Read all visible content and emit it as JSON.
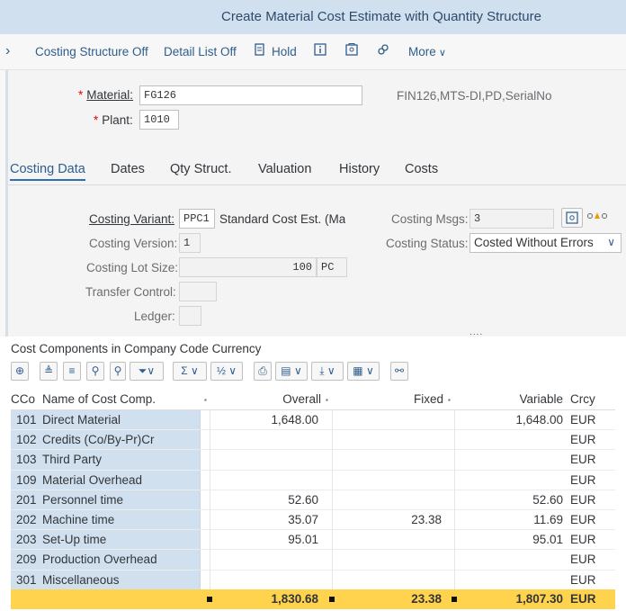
{
  "window": {
    "title": "Create Material Cost Estimate with Quantity Structure"
  },
  "toolbar": {
    "nav_chevron": "›",
    "costing_structure_off": "Costing Structure Off",
    "detail_list_off": "Detail List Off",
    "hold": "Hold",
    "more": "More"
  },
  "header": {
    "material_label": "Material:",
    "material_value": "FG126",
    "material_desc": "FIN126,MTS-DI,PD,SerialNo",
    "plant_label": "Plant:",
    "plant_value": "1010",
    "required_mark": "*"
  },
  "tabs": [
    {
      "label": "Costing Data",
      "active": true
    },
    {
      "label": "Dates"
    },
    {
      "label": "Qty Struct."
    },
    {
      "label": "Valuation"
    },
    {
      "label": "History"
    },
    {
      "label": "Costs"
    }
  ],
  "costing": {
    "variant_label": "Costing Variant:",
    "variant_value": "PPC1",
    "variant_desc": "Standard Cost Est. (Ma.",
    "version_label": "Costing Version:",
    "version_value": "1",
    "lot_size_label": "Costing Lot Size:",
    "lot_size_value": "100",
    "lot_size_unit": "PC",
    "transfer_label": "Transfer Control:",
    "ledger_label": "Ledger:",
    "msgs_label": "Costing Msgs:",
    "msgs_value": "3",
    "status_label": "Costing Status:",
    "status_value": "Costed Without Errors"
  },
  "section": {
    "title": "Cost Components in Company Code Currency",
    "splitter": "....",
    "columns": {
      "cco": "CCo",
      "name": "Name of Cost Comp.",
      "overall": "Overall",
      "fixed": "Fixed",
      "variable": "Variable",
      "crcy": "Crcy"
    },
    "rows": [
      {
        "cco": "101",
        "name": "Direct Material",
        "overall": "1,648.00",
        "fixed": "",
        "variable": "1,648.00",
        "crcy": "EUR"
      },
      {
        "cco": "102",
        "name": "Credits (Co/By-Pr)Cr",
        "overall": "",
        "fixed": "",
        "variable": "",
        "crcy": "EUR"
      },
      {
        "cco": "103",
        "name": "Third Party",
        "overall": "",
        "fixed": "",
        "variable": "",
        "crcy": "EUR"
      },
      {
        "cco": "109",
        "name": "Material Overhead",
        "overall": "",
        "fixed": "",
        "variable": "",
        "crcy": "EUR"
      },
      {
        "cco": "201",
        "name": "Personnel time",
        "overall": "52.60",
        "fixed": "",
        "variable": "52.60",
        "crcy": "EUR"
      },
      {
        "cco": "202",
        "name": "Machine time",
        "overall": "35.07",
        "fixed": "23.38",
        "variable": "11.69",
        "crcy": "EUR"
      },
      {
        "cco": "203",
        "name": "Set-Up time",
        "overall": "95.01",
        "fixed": "",
        "variable": "95.01",
        "crcy": "EUR"
      },
      {
        "cco": "209",
        "name": "Production Overhead",
        "overall": "",
        "fixed": "",
        "variable": "",
        "crcy": "EUR"
      },
      {
        "cco": "301",
        "name": "Miscellaneous",
        "overall": "",
        "fixed": "",
        "variable": "",
        "crcy": "EUR"
      }
    ],
    "total": {
      "overall": "1,830.68",
      "fixed": "23.38",
      "variable": "1,807.30",
      "crcy": "EUR"
    }
  },
  "colors": {
    "accent": "#2f5d8c",
    "key_column": "#d1e0ee",
    "total_row": "#ffd34d",
    "required": "#ee0000"
  }
}
